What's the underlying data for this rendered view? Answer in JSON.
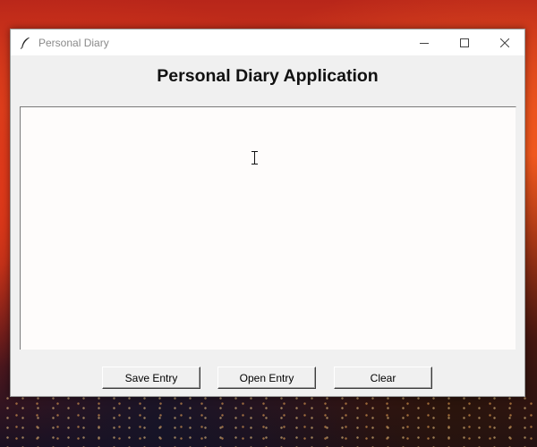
{
  "window": {
    "title": "Personal Diary",
    "app_icon": "feather-icon",
    "controls": [
      "minimize-icon",
      "maximize-icon",
      "close-icon"
    ]
  },
  "main": {
    "heading": "Personal Diary Application",
    "editor_value": ""
  },
  "buttons": {
    "save_label": "Save Entry",
    "open_label": "Open Entry",
    "clear_label": "Clear"
  },
  "colors": {
    "window_bg": "#f0f0f0",
    "titlebar_bg": "#ffffff",
    "editor_bg": "#fefcfb"
  }
}
